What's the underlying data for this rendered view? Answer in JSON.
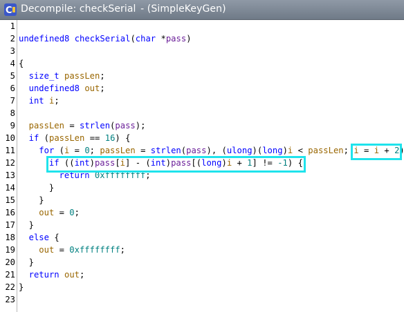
{
  "window": {
    "title": "Decompile: checkSerial",
    "subtitle": "- (SimpleKeyGen)",
    "icon": "decompile-icon",
    "highlight_color": "#1fe3ec"
  },
  "code": {
    "lines": [
      {
        "n": "1",
        "indent": 0,
        "tokens": []
      },
      {
        "n": "2",
        "indent": 0,
        "tokens": [
          [
            "type",
            "undefined8"
          ],
          [
            "plain",
            " "
          ],
          [
            "func",
            "checkSerial"
          ],
          [
            "plain",
            "("
          ],
          [
            "type",
            "char"
          ],
          [
            "plain",
            " *"
          ],
          [
            "param",
            "pass"
          ],
          [
            "plain",
            ")"
          ]
        ]
      },
      {
        "n": "3",
        "indent": 0,
        "tokens": []
      },
      {
        "n": "4",
        "indent": 0,
        "tokens": [
          [
            "plain",
            "{"
          ]
        ]
      },
      {
        "n": "5",
        "indent": 2,
        "tokens": [
          [
            "type",
            "size_t"
          ],
          [
            "plain",
            " "
          ],
          [
            "var",
            "passLen"
          ],
          [
            "plain",
            ";"
          ]
        ]
      },
      {
        "n": "6",
        "indent": 2,
        "tokens": [
          [
            "type",
            "undefined8"
          ],
          [
            "plain",
            " "
          ],
          [
            "var",
            "out"
          ],
          [
            "plain",
            ";"
          ]
        ]
      },
      {
        "n": "7",
        "indent": 2,
        "tokens": [
          [
            "type",
            "int"
          ],
          [
            "plain",
            " "
          ],
          [
            "var",
            "i"
          ],
          [
            "plain",
            ";"
          ]
        ]
      },
      {
        "n": "8",
        "indent": 0,
        "tokens": []
      },
      {
        "n": "9",
        "indent": 2,
        "tokens": [
          [
            "var",
            "passLen"
          ],
          [
            "plain",
            " = "
          ],
          [
            "func",
            "strlen"
          ],
          [
            "plain",
            "("
          ],
          [
            "param",
            "pass"
          ],
          [
            "plain",
            ");"
          ]
        ]
      },
      {
        "n": "10",
        "indent": 2,
        "tokens": [
          [
            "keyword",
            "if"
          ],
          [
            "plain",
            " ("
          ],
          [
            "var",
            "passLen"
          ],
          [
            "plain",
            " == "
          ],
          [
            "const",
            "16"
          ],
          [
            "plain",
            ") {"
          ]
        ]
      },
      {
        "n": "11",
        "indent": 4,
        "tokens": [
          [
            "keyword",
            "for"
          ],
          [
            "plain",
            " ("
          ],
          [
            "var",
            "i"
          ],
          [
            "plain",
            " = "
          ],
          [
            "const",
            "0"
          ],
          [
            "plain",
            "; "
          ],
          [
            "var",
            "passLen"
          ],
          [
            "plain",
            " = "
          ],
          [
            "func",
            "strlen"
          ],
          [
            "plain",
            "("
          ],
          [
            "param",
            "pass"
          ],
          [
            "plain",
            "), ("
          ],
          [
            "type",
            "ulong"
          ],
          [
            "plain",
            ")("
          ],
          [
            "type",
            "long"
          ],
          [
            "plain",
            ")"
          ],
          [
            "var",
            "i"
          ],
          [
            "plain",
            " < "
          ],
          [
            "var",
            "passLen"
          ],
          [
            "plain",
            "; "
          ],
          [
            "var",
            "i"
          ],
          [
            "plain",
            " = "
          ],
          [
            "var",
            "i"
          ],
          [
            "plain",
            " + "
          ],
          [
            "const",
            "2"
          ],
          [
            "plain",
            ") {"
          ]
        ]
      },
      {
        "n": "12",
        "indent": 6,
        "tokens": [
          [
            "keyword",
            "if"
          ],
          [
            "plain",
            " (("
          ],
          [
            "type",
            "int"
          ],
          [
            "plain",
            ")"
          ],
          [
            "param",
            "pass"
          ],
          [
            "plain",
            "["
          ],
          [
            "var",
            "i"
          ],
          [
            "plain",
            "] - ("
          ],
          [
            "type",
            "int"
          ],
          [
            "plain",
            ")"
          ],
          [
            "param",
            "pass"
          ],
          [
            "plain",
            "[("
          ],
          [
            "type",
            "long"
          ],
          [
            "plain",
            ")"
          ],
          [
            "var",
            "i"
          ],
          [
            "plain",
            " + "
          ],
          [
            "const",
            "1"
          ],
          [
            "plain",
            "] != "
          ],
          [
            "const",
            "-1"
          ],
          [
            "plain",
            ") {"
          ]
        ]
      },
      {
        "n": "13",
        "indent": 8,
        "tokens": [
          [
            "keyword",
            "return"
          ],
          [
            "plain",
            " "
          ],
          [
            "const",
            "0xffffffff"
          ],
          [
            "plain",
            ";"
          ]
        ]
      },
      {
        "n": "14",
        "indent": 6,
        "tokens": [
          [
            "plain",
            "}"
          ]
        ]
      },
      {
        "n": "15",
        "indent": 4,
        "tokens": [
          [
            "plain",
            "}"
          ]
        ]
      },
      {
        "n": "16",
        "indent": 4,
        "tokens": [
          [
            "var",
            "out"
          ],
          [
            "plain",
            " = "
          ],
          [
            "const",
            "0"
          ],
          [
            "plain",
            ";"
          ]
        ]
      },
      {
        "n": "17",
        "indent": 2,
        "tokens": [
          [
            "plain",
            "}"
          ]
        ]
      },
      {
        "n": "18",
        "indent": 2,
        "tokens": [
          [
            "keyword",
            "else"
          ],
          [
            "plain",
            " {"
          ]
        ]
      },
      {
        "n": "19",
        "indent": 4,
        "tokens": [
          [
            "var",
            "out"
          ],
          [
            "plain",
            " = "
          ],
          [
            "const",
            "0xffffffff"
          ],
          [
            "plain",
            ";"
          ]
        ]
      },
      {
        "n": "20",
        "indent": 2,
        "tokens": [
          [
            "plain",
            "}"
          ]
        ]
      },
      {
        "n": "21",
        "indent": 2,
        "tokens": [
          [
            "keyword",
            "return"
          ],
          [
            "plain",
            " "
          ],
          [
            "var",
            "out"
          ],
          [
            "plain",
            ";"
          ]
        ]
      },
      {
        "n": "22",
        "indent": 0,
        "tokens": [
          [
            "plain",
            "}"
          ]
        ]
      },
      {
        "n": "23",
        "indent": 0,
        "tokens": []
      }
    ]
  }
}
